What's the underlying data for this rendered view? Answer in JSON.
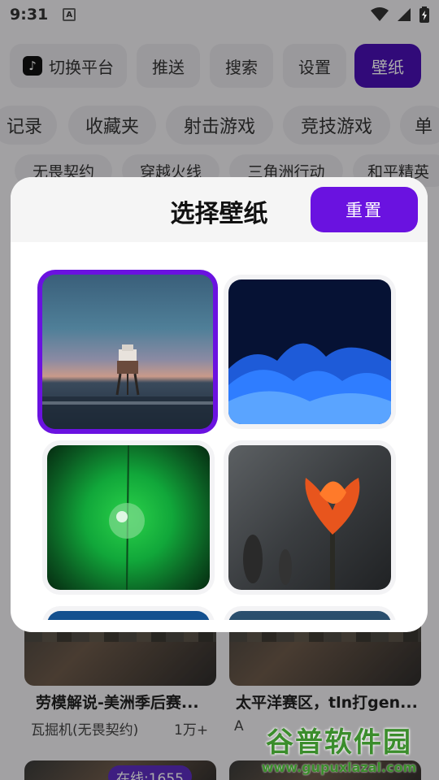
{
  "status": {
    "time": "9:31"
  },
  "top_chips": [
    "切换平台",
    "推送",
    "搜索",
    "设置",
    "壁纸"
  ],
  "categories": [
    "记录",
    "收藏夹",
    "射击游戏",
    "竞技游戏",
    "单"
  ],
  "games": [
    "无畏契约",
    "穿越火线",
    "三角洲行动",
    "和平精英"
  ],
  "modal": {
    "title": "选择壁纸",
    "reset_label": "重置"
  },
  "wallpapers": [
    {
      "name": "lighthouse-sunset",
      "selected": true
    },
    {
      "name": "blue-waves-abstract",
      "selected": false
    },
    {
      "name": "water-drop-leaf",
      "selected": false
    },
    {
      "name": "orange-tulip",
      "selected": false
    },
    {
      "name": "blue-partial-1",
      "selected": false
    },
    {
      "name": "blue-partial-2",
      "selected": false
    }
  ],
  "feed": [
    {
      "title": "劳模解说-美洲季后赛...",
      "sub": "瓦掘机(无畏契约)",
      "count": "1万+"
    },
    {
      "title": "太平洋赛区，tln打gen...",
      "sub": "A",
      "count": ""
    }
  ],
  "online_badge": "在线:1655",
  "watermark": {
    "big": "谷普软件园",
    "small": "www.gupuxlazal.com"
  }
}
